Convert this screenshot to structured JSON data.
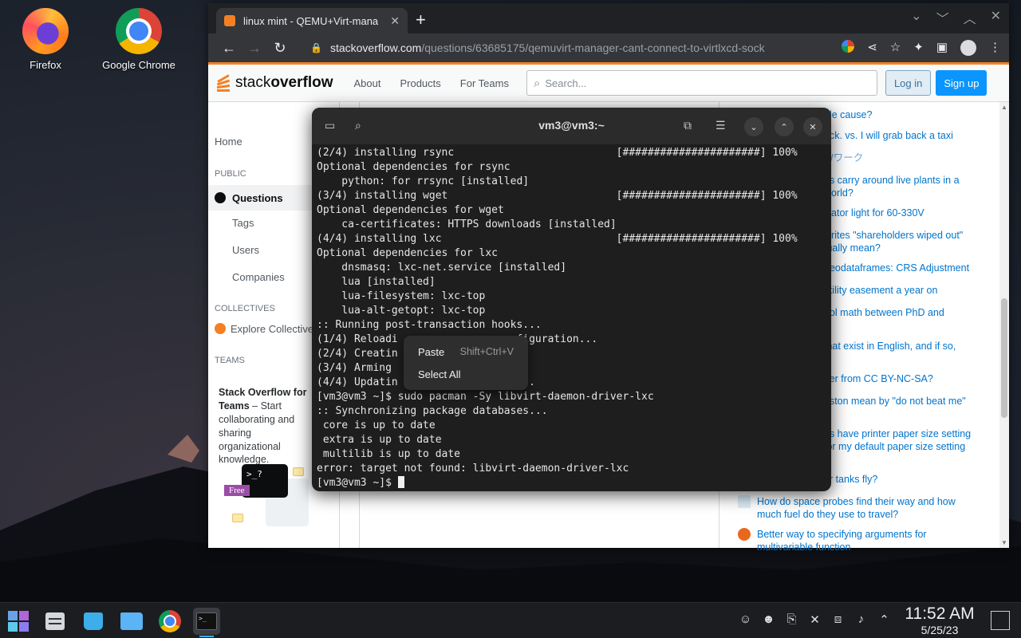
{
  "desktop": {
    "icons": [
      {
        "label": "Firefox",
        "icon": "firefox-icon"
      },
      {
        "label": "Google Chrome",
        "icon": "chrome-icon"
      }
    ]
  },
  "browser": {
    "tab_title": "linux mint - QEMU+Virt-mana",
    "url_host": "stackoverflow.com",
    "url_path": "/questions/63685175/qemuvirt-manager-cant-connect-to-virtlxcd-sock",
    "window_controls": [
      "chevron-down-icon",
      "minimize-icon",
      "maximize-icon",
      "close-icon"
    ]
  },
  "so": {
    "logo_light": "stack",
    "logo_bold": "overflow",
    "nav": [
      "About",
      "Products",
      "For Teams"
    ],
    "search_placeholder": "Search...",
    "login": "Log in",
    "signup": "Sign up",
    "left": {
      "home": "Home",
      "public": "PUBLIC",
      "questions": "Questions",
      "tags": "Tags",
      "users": "Users",
      "companies": "Companies",
      "collectives": "COLLECTIVES",
      "explore": "Explore Collectives",
      "teams": "TEAMS",
      "promo_title": "Stack Overflow for Teams",
      "promo_text": " – Start collaborating and sharing organizational knowledge.",
      "promo_free": "Free",
      "promo_term": ">_?"
    },
    "hot_questions": [
      "ble cause?",
      "ack. vs. I will grab back a taxi",
      "Wワーク",
      "ns carry around live plants in a world?",
      "icator light for 60-330V",
      "writes \"shareholders wiped out\" tually mean?",
      "geodataframes: CRS Adjustment",
      "utility easement a year on",
      "ool math between PhD and",
      "mat exist in English, and if so,",
      "ffer from CC BY-NC-SA?",
      "eston mean by \"do not beat me\"",
      "es have printer paper size setting for my default paper size setting",
      "er tanks fly?",
      "How do space probes find their way and how much fuel do they use to travel?",
      "Better way to specifying arguments for multivariable function"
    ]
  },
  "terminal": {
    "title": "vm3@vm3:~",
    "lines": [
      "(2/4) installing rsync                          [######################] 100%",
      "Optional dependencies for rsync",
      "    python: for rrsync [installed]",
      "(3/4) installing wget                           [######################] 100%",
      "Optional dependencies for wget",
      "    ca-certificates: HTTPS downloads [installed]",
      "(4/4) installing lxc                            [######################] 100%",
      "Optional dependencies for lxc",
      "    dnsmasq: lxc-net.service [installed]",
      "    lua [installed]",
      "    lua-filesystem: lxc-top",
      "    lua-alt-getopt: lxc-top",
      ":: Running post-transaction hooks...",
      "(1/4) Reloadi                 onfiguration...",
      "(2/4) Creatin",
      "(3/4) Arming                  ...",
      "(4/4) Updatin                 le...",
      "[vm3@vm3 ~]$ sudo pacman -Sy libvirt-daemon-driver-lxc",
      ":: Synchronizing package databases...",
      " core is up to date",
      " extra is up to date",
      " multilib is up to date",
      "error: target not found: libvirt-daemon-driver-lxc",
      "[vm3@vm3 ~]$ "
    ],
    "context_menu": {
      "paste": "Paste",
      "paste_shortcut": "Shift+Ctrl+V",
      "select_all": "Select All"
    }
  },
  "taskbar": {
    "time": "11:52 AM",
    "date": "5/25/23",
    "apps": [
      "start-menu-icon",
      "settings-icon",
      "store-icon",
      "file-manager-icon",
      "chrome-icon",
      "terminal-icon"
    ],
    "tray": [
      "user-icon",
      "user-switch-icon",
      "clipboard-icon",
      "mute-icon",
      "network-icon",
      "volume-icon",
      "tray-expand-icon"
    ]
  }
}
